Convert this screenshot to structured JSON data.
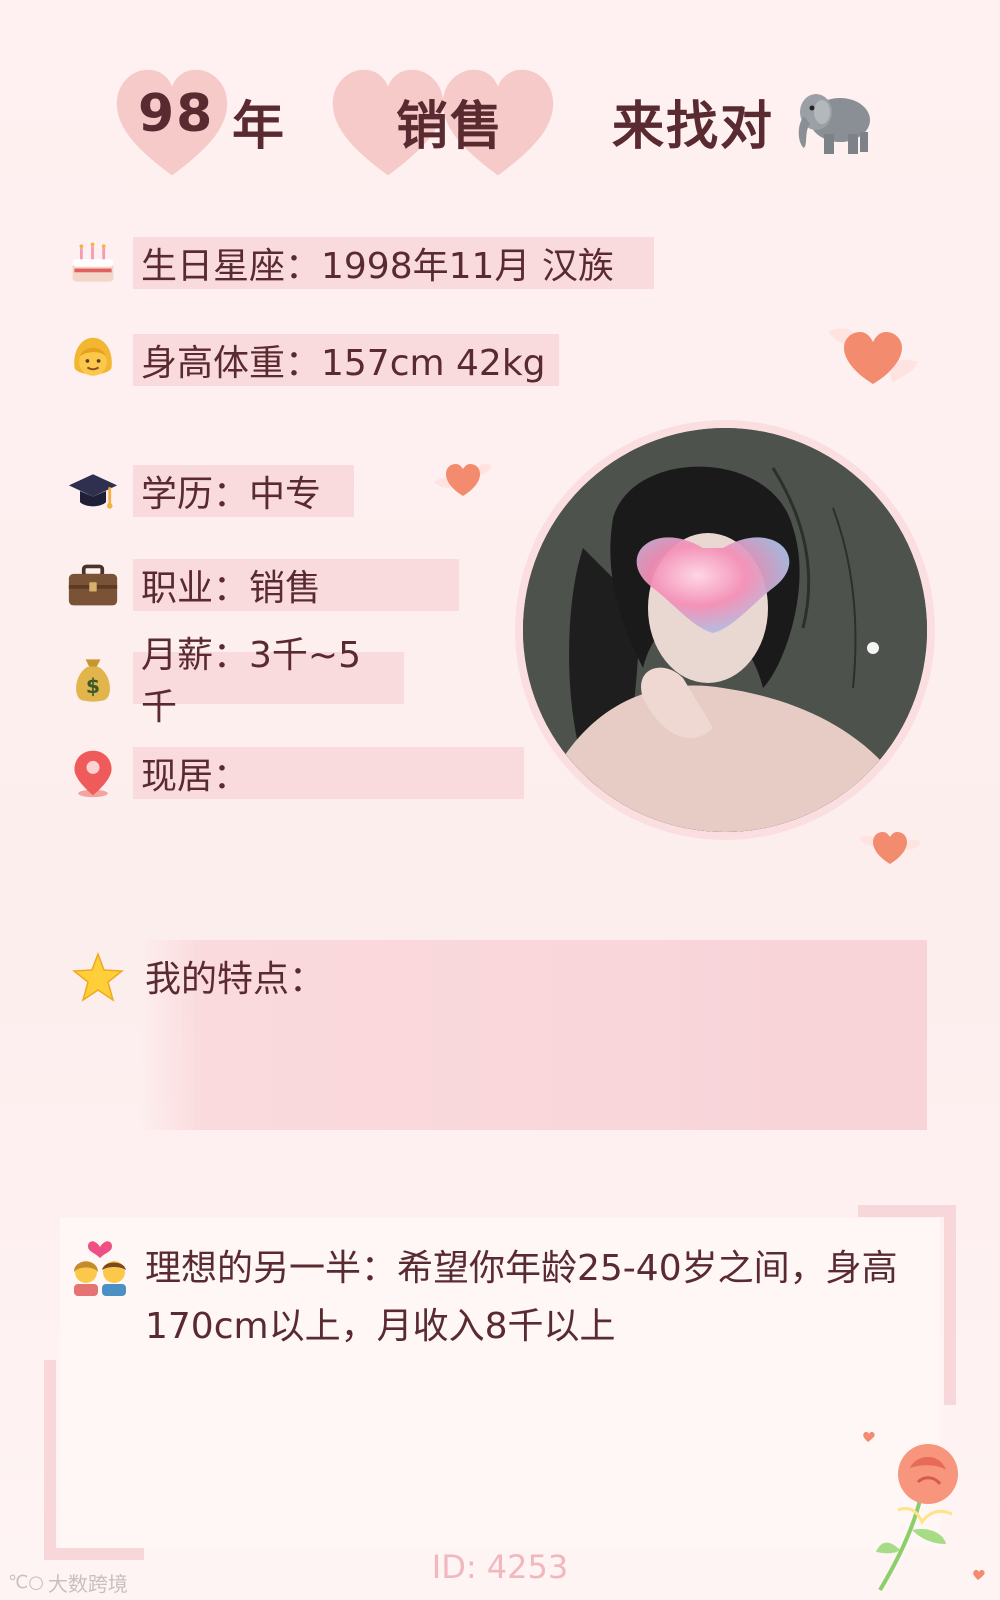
{
  "header": {
    "year": "98",
    "year_suffix": "年",
    "job": "销售",
    "tagline": "来找对"
  },
  "info": [
    {
      "icon": "birthday-cake-icon",
      "text": "生日星座：1998年11月 汉族"
    },
    {
      "icon": "woman-icon",
      "text": "身高体重：157cm 42kg"
    },
    {
      "icon": "graduation-cap-icon",
      "text": "学历：中专"
    },
    {
      "icon": "briefcase-icon",
      "text": "职业：销售"
    },
    {
      "icon": "money-bag-icon",
      "text": "月薪：3千~5千"
    },
    {
      "icon": "location-pin-icon",
      "text": "现居："
    }
  ],
  "features": {
    "title": "我的特点："
  },
  "ideal": {
    "text": "理想的另一半：希望你年龄25-40岁之间，身高170cm以上，月收入8千以上"
  },
  "footer": {
    "id": "ID: 4253",
    "watermark": "大数跨境"
  },
  "colors": {
    "background": "#fdeeee",
    "highlight": "#fadbdd",
    "heart": "#f7c9cc",
    "text": "#5a2a31"
  }
}
